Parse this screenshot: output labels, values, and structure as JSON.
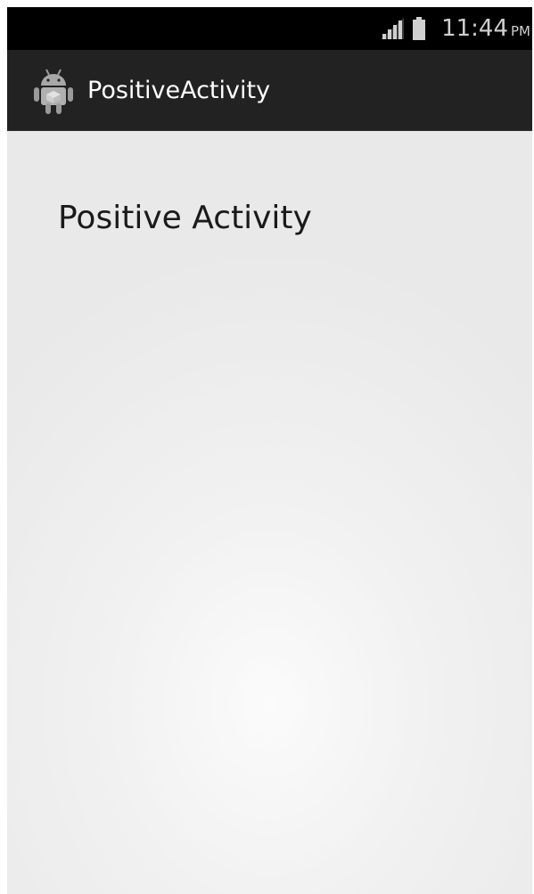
{
  "status_bar": {
    "time": "11:44",
    "ampm": "PM",
    "icons": [
      "signal-icon",
      "battery-icon"
    ],
    "background_color": "#000000"
  },
  "action_bar": {
    "title": "PositiveActivity",
    "icon": "android-app-icon",
    "background_color": "#222222",
    "title_color": "#ffffff"
  },
  "content": {
    "text": "Positive Activity",
    "background_color": "#eeeeee"
  }
}
